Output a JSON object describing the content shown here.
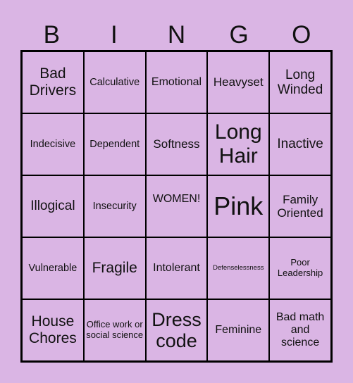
{
  "title_letters": [
    "B",
    "I",
    "N",
    "G",
    "O"
  ],
  "cells": [
    "Bad Drivers",
    "Calculative",
    "Emotional",
    "Heavyset",
    "Long Winded",
    "Indecisive",
    "Dependent",
    "Softness",
    "Long Hair",
    "Inactive",
    "Illogical",
    "Insecurity",
    "WOMEN!",
    "Pink",
    "Family Oriented",
    "Vulnerable",
    "Fragile",
    "Intolerant",
    "Defenselessness",
    "Poor Leadership",
    "House Chores",
    "Office work or social science",
    "Dress code",
    "Feminine",
    "Bad math and science"
  ],
  "colors": {
    "background": "#dab5e4",
    "border": "#000000",
    "text": "#111111"
  }
}
